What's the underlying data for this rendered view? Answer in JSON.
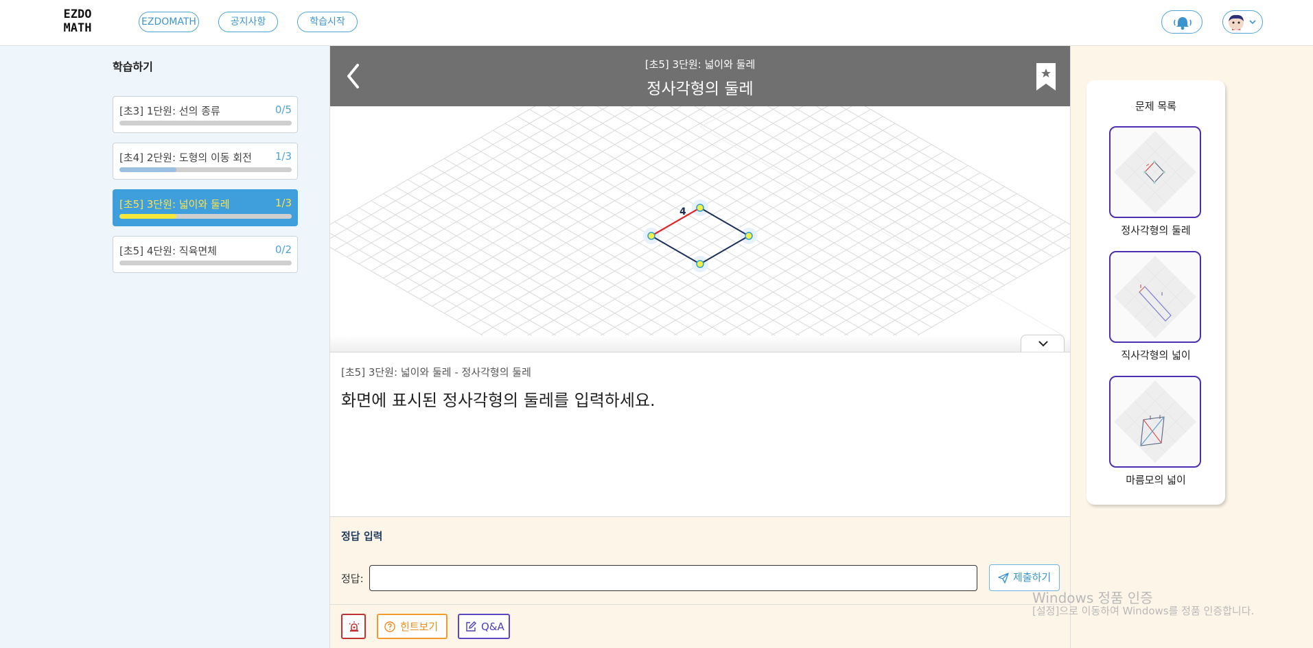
{
  "header": {
    "logo_line1": "EZDO",
    "logo_line2": "MATH",
    "nav": [
      "EZDOMATH",
      "공지사항",
      "학습시작"
    ],
    "notification_icon": "bell-icon",
    "avatar_icon": "avatar-icon"
  },
  "sidebar": {
    "title": "학습하기",
    "units": [
      {
        "label": "[초3] 1단원: 선의 종류",
        "count": "0/5",
        "progress": 0.0,
        "active": false
      },
      {
        "label": "[초4] 2단원: 도형의 이동 회전",
        "count": "1/3",
        "progress": 0.33,
        "active": false
      },
      {
        "label": "[초5] 3단원: 넓이와 둘레",
        "count": "1/3",
        "progress": 0.33,
        "active": true
      },
      {
        "label": "[초5] 4단원: 직육면체",
        "count": "0/2",
        "progress": 0.0,
        "active": false
      }
    ]
  },
  "main": {
    "subtitle": "[초5] 3단원: 넓이와 둘레",
    "title": "정사각형의 둘레",
    "canvas_side_label": "4",
    "breadcrumb": "[초5] 3단원: 넓이와 둘레 - 정사각형의 둘레",
    "question": "화면에 표시된 정사각형의 둘레를 입력하세요.",
    "answer": {
      "section_title": "정답 입력",
      "label": "정답:",
      "value": "",
      "submit_label": "제출하기"
    },
    "tools": {
      "hint_label": "힌트보기",
      "qna_label": "Q&A"
    }
  },
  "problem_list": {
    "title": "문제 목록",
    "items": [
      {
        "label": "정사각형의 둘레"
      },
      {
        "label": "직사각형의 넓이"
      },
      {
        "label": "마름모의 넓이"
      }
    ]
  },
  "watermark": {
    "line1": "Windows 정품 인증",
    "line2": "[설정]으로 이동하여 Windows를 정품 인증합니다."
  },
  "colors": {
    "accent": "#3f9fdc",
    "active_text": "#ffe34a",
    "header_bar": "#707070",
    "answer_bg": "#fdf5e8",
    "thumb_border": "#4b2fb0"
  }
}
